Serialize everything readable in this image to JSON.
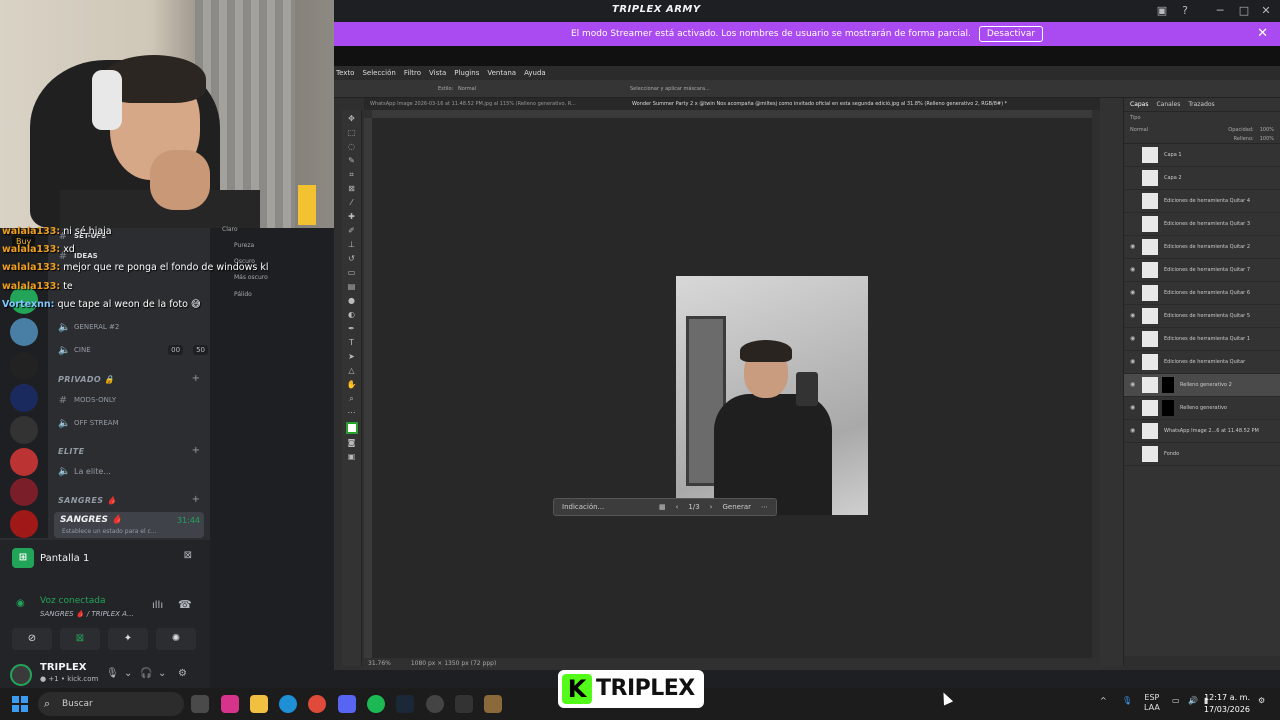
{
  "window": {
    "title": "TRIPLEX ARMY"
  },
  "streamer": {
    "message": "El modo Streamer está activado. Los nombres de usuario se mostrarán de forma parcial.",
    "button": "Desactivar"
  },
  "photoshop": {
    "menu": [
      "Texto",
      "Selección",
      "Filtro",
      "Vista",
      "Plugins",
      "Ventana",
      "Ayuda"
    ],
    "options": {
      "style_label": "Estilo:",
      "style_value": "Normal",
      "select_mask": "Seleccionar y aplicar máscara..."
    },
    "tabs": [
      "WhatsApp Image 2026-03-16 at 11.48.52 PM.jpg al 115% (Relleno generativo, R...",
      "Wonder Summer Party 2 x @twin Nos acompaña @miltesj como invitado oficial en esta segunda edició.jpg al 31.8% (Relleno generativo 2, RGB/8#) *"
    ],
    "zoom": "31.76%",
    "doc_size": "1080 px × 1350 px (72 ppp)",
    "context_bar": {
      "prompt": "Indicación...",
      "page": "1/3",
      "generate": "Generar"
    },
    "layer_tabs": [
      "Capas",
      "Canales",
      "Trazados"
    ],
    "layer_filter": {
      "kind": "Tipo",
      "blend": "Normal",
      "opacity_label": "Opacidad:",
      "opacity": "100%",
      "fill_label": "Relleno:",
      "fill": "100%"
    },
    "layers": [
      {
        "name": "Capa 1",
        "visible": false,
        "mask": false,
        "selected": false
      },
      {
        "name": "Capa 2",
        "visible": false,
        "mask": false,
        "selected": false
      },
      {
        "name": "Ediciones de herramienta Quitar 4",
        "visible": false,
        "mask": false,
        "selected": false
      },
      {
        "name": "Ediciones de herramienta Quitar 3",
        "visible": false,
        "mask": false,
        "selected": false
      },
      {
        "name": "Ediciones de herramienta Quitar 2",
        "visible": true,
        "mask": false,
        "selected": false
      },
      {
        "name": "Ediciones de herramienta Quitar 7",
        "visible": true,
        "mask": false,
        "selected": false
      },
      {
        "name": "Ediciones de herramienta Quitar 6",
        "visible": true,
        "mask": false,
        "selected": false
      },
      {
        "name": "Ediciones de herramienta Quitar 5",
        "visible": true,
        "mask": false,
        "selected": false
      },
      {
        "name": "Ediciones de herramienta Quitar 1",
        "visible": true,
        "mask": false,
        "selected": false
      },
      {
        "name": "Ediciones de herramienta Quitar",
        "visible": true,
        "mask": false,
        "selected": false
      },
      {
        "name": "Relleno generativo 2",
        "visible": true,
        "mask": true,
        "selected": true
      },
      {
        "name": "Relleno generativo",
        "visible": true,
        "mask": true,
        "selected": false
      },
      {
        "name": "WhatsApp Image 2...6 at 11.48.52 PM",
        "visible": true,
        "mask": false,
        "selected": false
      },
      {
        "name": "Fondo",
        "visible": false,
        "mask": false,
        "selected": false
      }
    ],
    "folders": [
      "Claro",
      "Pureza",
      "Oscuro",
      "Más oscuro",
      "Pálido"
    ]
  },
  "chat": [
    {
      "user": "walala133:",
      "text": "ni sé hjaja"
    },
    {
      "user": "walala133:",
      "text": "xd"
    },
    {
      "user": "walala133:",
      "text": "mejor que re ponga el fondo de windows kl"
    },
    {
      "user": "walala133:",
      "text": "te"
    },
    {
      "user": "Vortexnn:",
      "text": "que tape al weon de la foto 😅"
    }
  ],
  "discord": {
    "channels": [
      {
        "name": "SET-UPS",
        "icon": "#"
      },
      {
        "name": "IDEAS",
        "icon": "#"
      },
      {
        "name": "GENERAL #2",
        "icon": "🔊"
      },
      {
        "name": "CINE",
        "icon": "🔊",
        "badge1": "00",
        "badge2": "50"
      }
    ],
    "cat_privado": "PRIVADO 🔒",
    "private_channels": [
      {
        "name": "MODS-ONLY"
      },
      {
        "name": "OFF STREAM"
      }
    ],
    "cat_elite": "ELITE",
    "elite_channel": "La elite...",
    "cat_sangres": "SANGRES 🩸",
    "active_channel": {
      "name": "SANGRES 🩸",
      "time": "31:44",
      "status": "Establece un estado para el c..."
    },
    "stream": {
      "title": "Pantalla 1",
      "voice_status": "Voz conectada",
      "voice_sub": "SANGRES 🩸 / TRIPLEX A..."
    },
    "user": {
      "name": "TRIPLEX",
      "status": "● +1 • kick.com"
    },
    "buy": "Buy"
  },
  "taskbar": {
    "search": "Buscar",
    "lang": "ESP",
    "region": "LAA",
    "time": "12:17 a. m.",
    "date": "17/03/2026"
  },
  "overlay": {
    "brand": "TRIPLEX",
    "k": "K"
  }
}
